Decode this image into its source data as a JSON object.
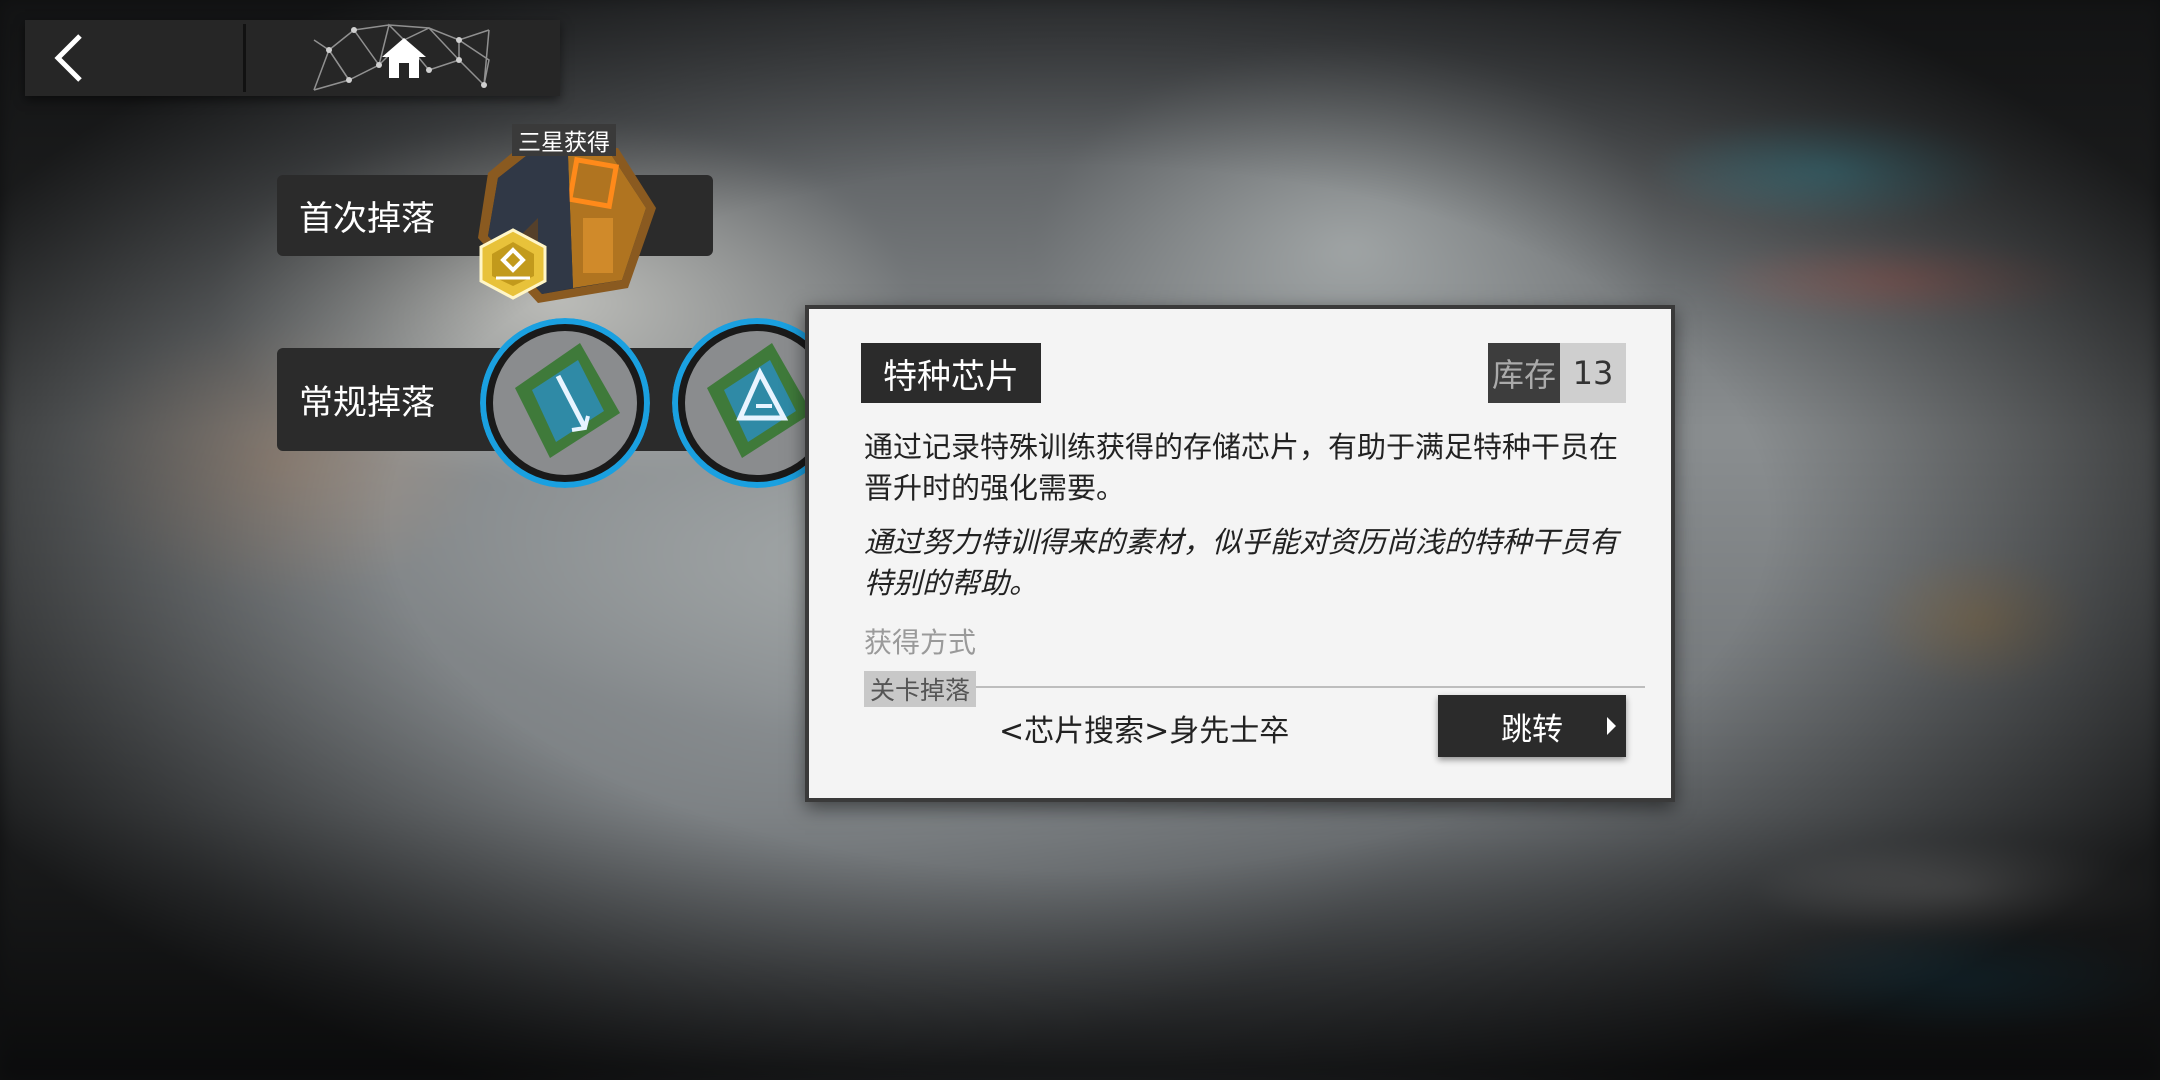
{
  "nav": {
    "back_icon": "chevron-left-icon",
    "home_icon": "home-icon"
  },
  "drops": {
    "first_drop_label": "首次掉落",
    "first_drop_badge": "三星获得",
    "regular_drop_label": "常规掉落"
  },
  "item": {
    "name": "特种芯片",
    "stock_label": "库存",
    "stock_value": "13",
    "description": "通过记录特殊训练获得的存储芯片，有助于满足特种干员在晋升时的强化需要。",
    "flavor": "通过努力特训得来的素材，似乎能对资历尚浅的特种干员有特别的帮助。",
    "obtain_title": "获得方式",
    "obtain_tag": "关卡掉落",
    "stage_name": "<芯片搜索>身先士卒",
    "jump_label": "跳转"
  },
  "colors": {
    "accent_blue": "#1aa0e0",
    "panel_dark": "#2b2b2b",
    "card_bg": "#f4f4f4"
  }
}
